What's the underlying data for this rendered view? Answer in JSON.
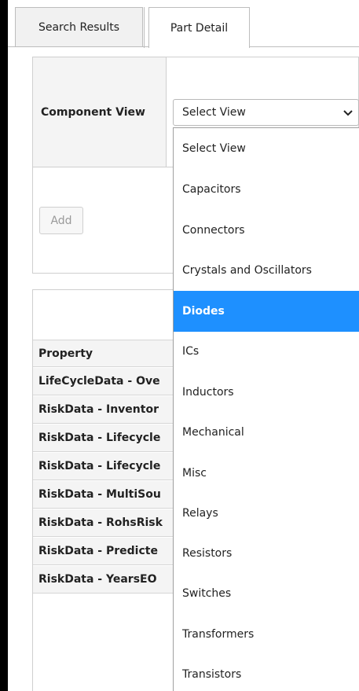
{
  "tabs": [
    {
      "label": "Search Results",
      "active": false
    },
    {
      "label": "Part Detail",
      "active": true
    }
  ],
  "component_view": {
    "label": "Component View",
    "select_value": "Select View",
    "add_label": "Add"
  },
  "dropdown": {
    "options": [
      "Select View",
      "Capacitors",
      "Connectors",
      "Crystals and Oscillators",
      "Diodes",
      "ICs",
      "Inductors",
      "Mechanical",
      "Misc",
      "Relays",
      "Resistors",
      "Switches",
      "Transformers",
      "Transistors"
    ],
    "highlighted": "Diodes",
    "highlight_color": "#1e90ff"
  },
  "property_table": {
    "header": "Property",
    "rows": [
      "LifeCycleData - Ove",
      "RiskData - Inventor",
      "RiskData - Lifecycle",
      "RiskData - Lifecycle",
      "RiskData - MultiSou",
      "RiskData - RohsRisk",
      "RiskData - Predicte",
      "RiskData - YearsEO"
    ]
  }
}
